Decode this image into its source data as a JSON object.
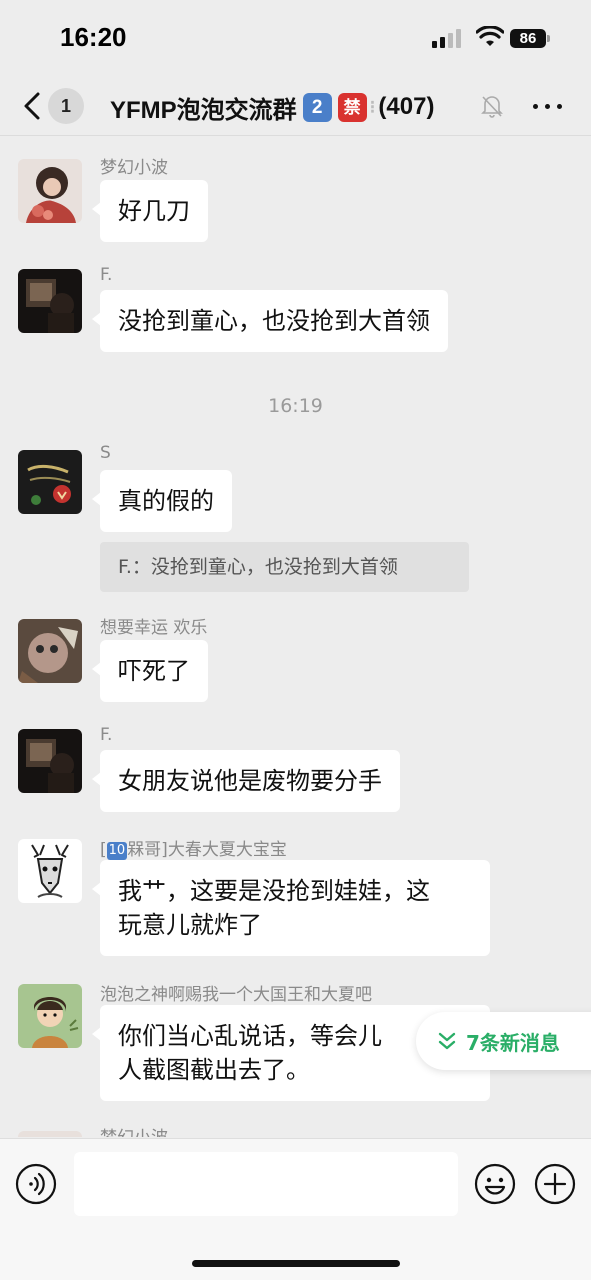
{
  "status_bar": {
    "time": "16:20",
    "battery": "86"
  },
  "nav": {
    "unread_count": "1",
    "title": "YFMP泡泡交流群",
    "emoji_key": "2",
    "emoji_ban": "禁",
    "member_count": "(407)",
    "icons": [
      "back-icon",
      "mute-bell-icon",
      "more-dots-icon"
    ]
  },
  "messages": [
    {
      "sender": "梦幻小波",
      "text": "好几刀",
      "avatar": "girl-photo"
    },
    {
      "sender": "F.",
      "text": "没抢到童心，也没抢到大首领",
      "avatar": "dark-photo"
    },
    {
      "separator": "16:19"
    },
    {
      "sender": "S",
      "text": "真的假的",
      "avatar": "black-shirt-photo",
      "quote": "F.：没抢到童心，也没抢到大首领"
    },
    {
      "sender": "想要幸运 欢乐",
      "text": "吓死了",
      "avatar": "cat-photo"
    },
    {
      "sender": "F.",
      "text": "女朋友说他是废物要分手",
      "avatar": "dark-photo"
    },
    {
      "sender_prefix": "[",
      "sender_tag": "10",
      "sender": "槑哥]大春大夏大宝宝",
      "text_line1": "我艹，这要是没抢到娃娃，这",
      "text_line2": "玩意儿就炸了",
      "avatar": "deer-sketch"
    },
    {
      "sender": "泡泡之神啊赐我一个大国王和大夏吧",
      "text_line1": "你们当心乱说话，等会儿",
      "text_line2": "人截图截出去了。",
      "avatar": "cartoon-boy"
    },
    {
      "sender": "梦幻小波",
      "avatar": "girl-photo"
    }
  ],
  "new_messages_label": "7条新消息",
  "input_bar": {
    "icons": [
      "voice-icon",
      "emoji-icon",
      "plus-icon"
    ]
  },
  "colors": {
    "background": "#ededed",
    "bubble": "#ffffff",
    "accent_green": "#2aae67"
  }
}
